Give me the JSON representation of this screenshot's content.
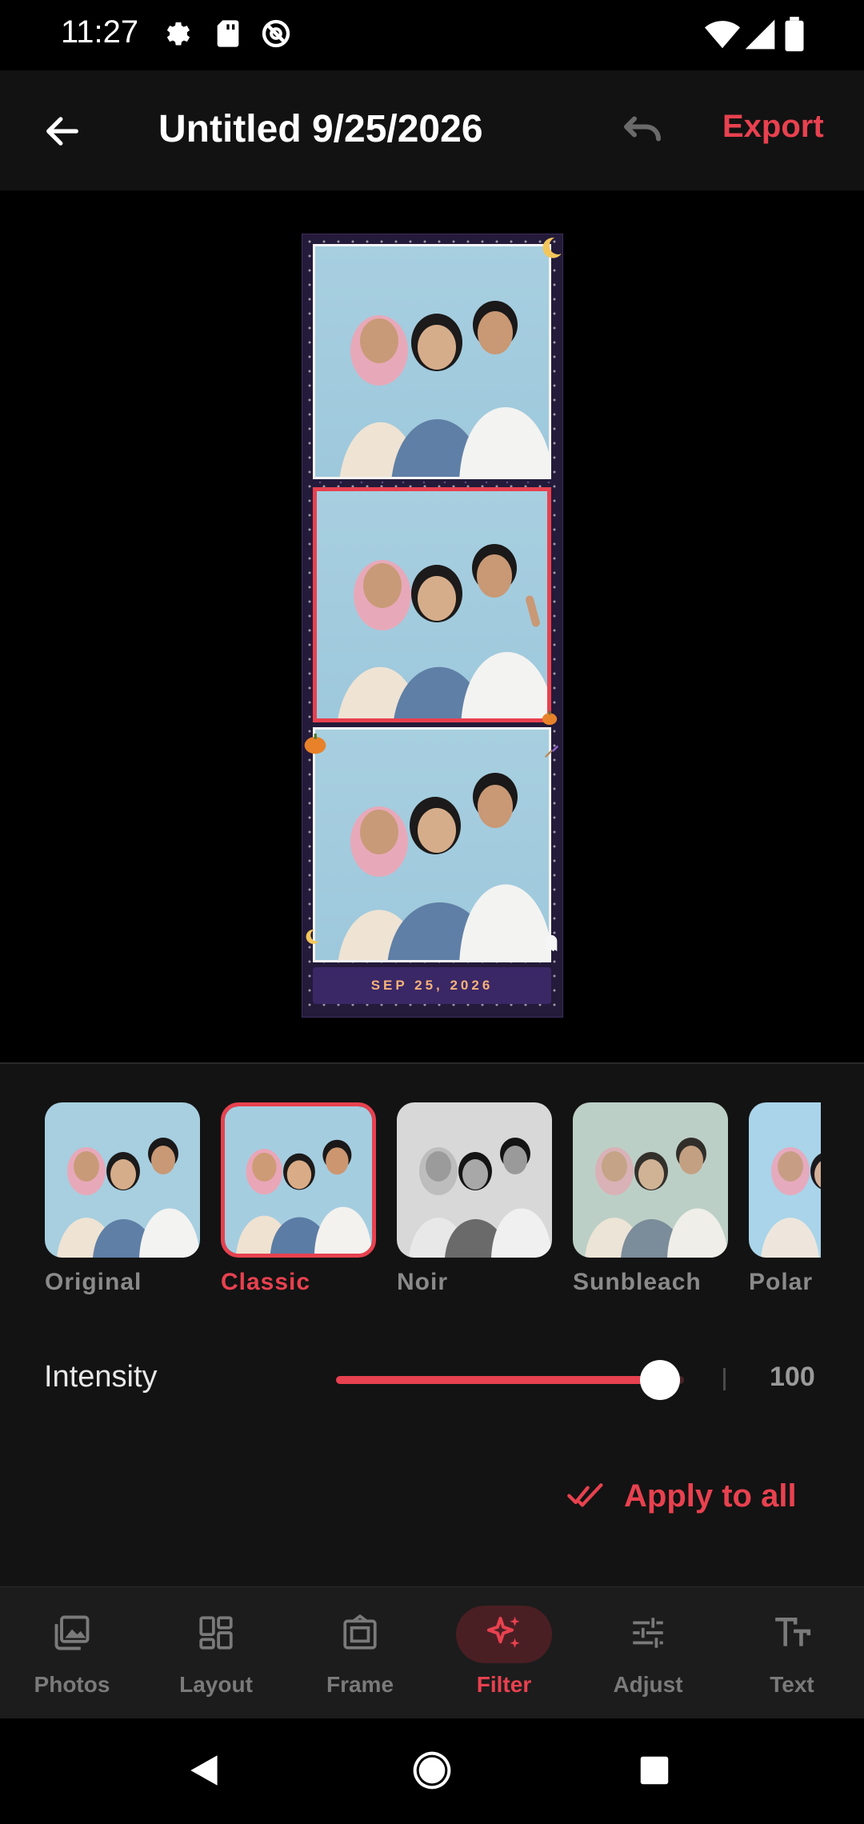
{
  "status_bar": {
    "time": "11:27",
    "left_icons": [
      "settings-icon",
      "sd-card-icon",
      "no-sync-icon"
    ],
    "right_icons": [
      "wifi-icon",
      "signal-icon",
      "battery-icon"
    ]
  },
  "app_bar": {
    "title": "Untitled 9/25/2026",
    "back_icon": "arrow-left-icon",
    "undo_icon": "undo-icon",
    "export_label": "Export"
  },
  "photo_strip": {
    "date_text": "SEP 25, 2026",
    "photos": [
      "photo-1",
      "photo-2",
      "photo-3"
    ],
    "selected_index": 1,
    "stickers": [
      "moon-icon",
      "pumpkin-icon",
      "pumpkin-icon",
      "broom-icon",
      "moon-icon",
      "ghost-icon"
    ]
  },
  "filters": {
    "items": [
      {
        "label": "Original"
      },
      {
        "label": "Classic"
      },
      {
        "label": "Noir"
      },
      {
        "label": "Sunbleach"
      },
      {
        "label": "Polar"
      }
    ],
    "selected": "Classic"
  },
  "intensity": {
    "label": "Intensity",
    "value": "100",
    "fraction": 0.93
  },
  "apply_all": {
    "icon": "double-check-icon",
    "label": "Apply to all"
  },
  "bottom_nav": {
    "items": [
      {
        "label": "Photos",
        "icon": "photos-icon"
      },
      {
        "label": "Layout",
        "icon": "layout-icon"
      },
      {
        "label": "Frame",
        "icon": "frame-icon"
      },
      {
        "label": "Filter",
        "icon": "sparkles-icon"
      },
      {
        "label": "Adjust",
        "icon": "sliders-icon"
      },
      {
        "label": "Text",
        "icon": "text-size-icon"
      }
    ],
    "active": "Filter"
  },
  "system_nav": {
    "icons": [
      "back-triangle-icon",
      "home-circle-icon",
      "recents-square-icon"
    ]
  },
  "colors": {
    "accent": "#e8414f",
    "panel": "#131313",
    "nav_background": "#1c1c1c",
    "frame_purple": "#241a3a"
  }
}
